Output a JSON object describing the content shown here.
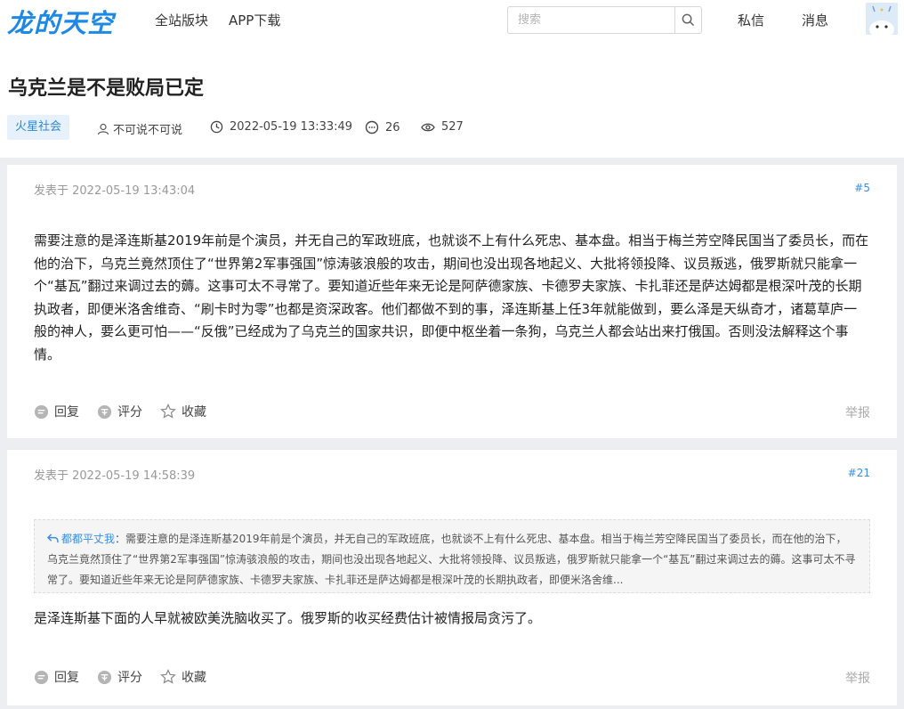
{
  "header": {
    "logo": "龙的天空",
    "nav": [
      "全站版块",
      "APP下载"
    ],
    "search": {
      "placeholder": "搜索"
    },
    "nav_right": [
      "私信",
      "消息"
    ]
  },
  "thread": {
    "title": "乌克兰是不是败局已定",
    "tag": "火星社会",
    "author": "不可说不可说",
    "datetime": "2022-05-19 13:33:49",
    "comments": "26",
    "views": "527"
  },
  "posts": [
    {
      "time": "发表于 2022-05-19 13:43:04",
      "floor": "#5",
      "content": "需要注意的是泽连斯基2019年前是个演员，并无自己的军政班底，也就谈不上有什么死忠、基本盘。相当于梅兰芳空降民国当了委员长，而在他的治下，乌克兰竟然顶住了“世界第2军事强国”惊涛骇浪般的攻击，期间也没出现各地起义、大批将领投降、议员叛逃，俄罗斯就只能拿一个“基瓦”翻过来调过去的薅。这事可太不寻常了。要知道近些年来无论是阿萨德家族、卡德罗夫家族、卡扎菲还是萨达姆都是根深叶茂的长期执政者，即便米洛舍维奇、“刷卡时为零”也都是资深政客。他们都做不到的事，泽连斯基上任3年就能做到，要么泽是天纵奇才，诸葛草庐一般的神人，要么更可怕——“反俄”已经成为了乌克兰的国家共识，即便中枢坐着一条狗，乌克兰人都会站出来打俄国。否则没法解释这个事情。",
      "actions": [
        "回复",
        "评分",
        "收藏"
      ],
      "report": "举报"
    },
    {
      "time": "发表于 2022-05-19 14:58:39",
      "floor": "#21",
      "quote_author": "都都平丈我",
      "quote_text": "：需要注意的是泽连斯基2019年前是个演员，并无自己的军政班底，也就谈不上有什么死忠、基本盘。相当于梅兰芳空降民国当了委员长，而在他的治下，乌克兰竟然顶住了“世界第2军事强国”惊涛骇浪般的攻击，期间也没出现各地起义、大批将领投降、议员叛逃，俄罗斯就只能拿一个“基瓦”翻过来调过去的薅。这事可太不寻常了。要知道近些年来无论是阿萨德家族、卡德罗夫家族、卡扎菲还是萨达姆都是根深叶茂的长期执政者，即便米洛舍维...",
      "content": "是泽连斯基下面的人早就被欧美洗脑收买了。俄罗斯的收买经费估计被情报局贪污了。",
      "actions": [
        "回复",
        "评分",
        "收藏"
      ],
      "report": "举报"
    }
  ]
}
